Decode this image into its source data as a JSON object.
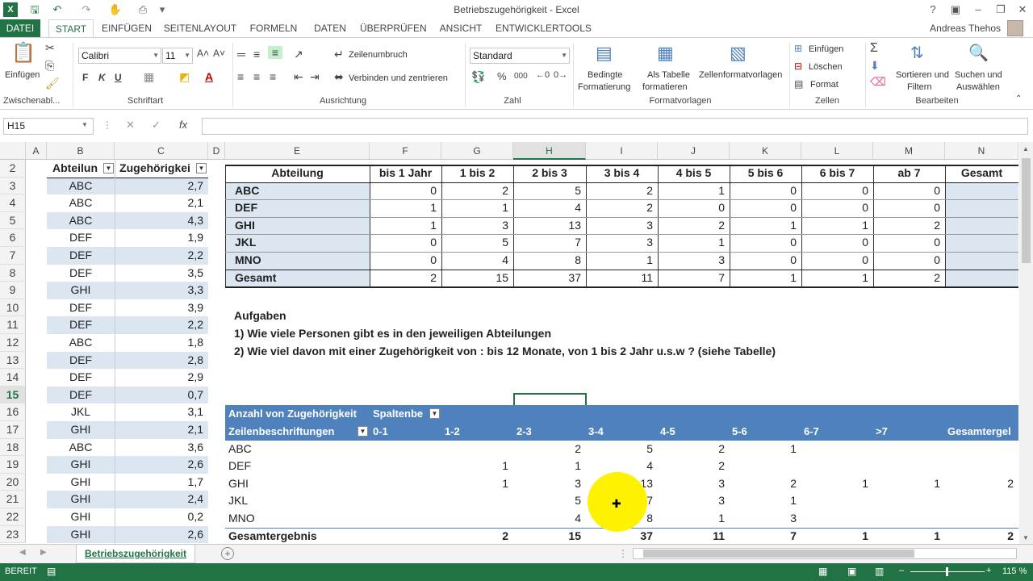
{
  "window": {
    "title": "Betriebszugehörigkeit - Excel",
    "user": "Andreas Thehos"
  },
  "qat": {
    "save_icon": "save-icon",
    "undo_icon": "undo-icon",
    "redo_icon": "redo-icon"
  },
  "tabs": [
    "DATEI",
    "START",
    "EINFÜGEN",
    "SEITENLAYOUT",
    "FORMELN",
    "DATEN",
    "ÜBERPRÜFEN",
    "ANSICHT",
    "ENTWICKLERTOOLS"
  ],
  "ribbon": {
    "clipboard": {
      "paste": "Einfügen",
      "label": "Zwischenabl..."
    },
    "font": {
      "name": "Calibri",
      "size": "11",
      "bold": "F",
      "italic": "K",
      "underline": "U",
      "label": "Schriftart"
    },
    "alignment": {
      "wrap": "Zeilenumbruch",
      "merge": "Verbinden und zentrieren",
      "label": "Ausrichtung"
    },
    "number": {
      "format": "Standard",
      "percent": "%",
      "thousands": "000",
      "label": "Zahl"
    },
    "styles": {
      "conditional1": "Bedingte",
      "conditional2": "Formatierung",
      "table1": "Als Tabelle",
      "table2": "formatieren",
      "cellstyles": "Zellenformatvorlagen",
      "label": "Formatvorlagen"
    },
    "cells": {
      "insert": "Einfügen",
      "delete": "Löschen",
      "format": "Format",
      "label": "Zellen"
    },
    "editing": {
      "sort1": "Sortieren und",
      "sort2": "Filtern",
      "find1": "Suchen und",
      "find2": "Auswählen",
      "label": "Bearbeiten"
    }
  },
  "formula": {
    "namebox": "H15",
    "fx": "fx",
    "value": ""
  },
  "columns": [
    "A",
    "B",
    "C",
    "D",
    "E",
    "F",
    "G",
    "H",
    "I",
    "J",
    "K",
    "L",
    "M",
    "N"
  ],
  "rows": [
    "2",
    "3",
    "4",
    "5",
    "6",
    "7",
    "8",
    "9",
    "10",
    "11",
    "12",
    "13",
    "14",
    "15",
    "16",
    "17",
    "18",
    "19",
    "20",
    "21",
    "22",
    "23"
  ],
  "left_table": {
    "headers": [
      "Abteilun",
      "Zugehörigkei"
    ],
    "rows": [
      [
        "ABC",
        "2,7"
      ],
      [
        "ABC",
        "2,1"
      ],
      [
        "ABC",
        "4,3"
      ],
      [
        "DEF",
        "1,9"
      ],
      [
        "DEF",
        "2,2"
      ],
      [
        "DEF",
        "3,5"
      ],
      [
        "GHI",
        "3,3"
      ],
      [
        "DEF",
        "3,9"
      ],
      [
        "DEF",
        "2,2"
      ],
      [
        "ABC",
        "1,8"
      ],
      [
        "DEF",
        "2,8"
      ],
      [
        "DEF",
        "2,9"
      ],
      [
        "DEF",
        "0,7"
      ],
      [
        "JKL",
        "3,1"
      ],
      [
        "GHI",
        "2,1"
      ],
      [
        "ABC",
        "3,6"
      ],
      [
        "GHI",
        "2,6"
      ],
      [
        "GHI",
        "1,7"
      ],
      [
        "GHI",
        "2,4"
      ],
      [
        "GHI",
        "0,2"
      ],
      [
        "GHI",
        "2,6"
      ]
    ]
  },
  "summary_table": {
    "headers": [
      "Abteilung",
      "bis 1 Jahr",
      "1 bis 2",
      "2 bis 3",
      "3 bis 4",
      "4 bis 5",
      "5 bis 6",
      "6 bis 7",
      "ab 7",
      "Gesamt"
    ],
    "rows": [
      [
        "ABC",
        "0",
        "2",
        "5",
        "2",
        "1",
        "0",
        "0",
        "0",
        ""
      ],
      [
        "DEF",
        "1",
        "1",
        "4",
        "2",
        "0",
        "0",
        "0",
        "0",
        ""
      ],
      [
        "GHI",
        "1",
        "3",
        "13",
        "3",
        "2",
        "1",
        "1",
        "2",
        ""
      ],
      [
        "JKL",
        "0",
        "5",
        "7",
        "3",
        "1",
        "0",
        "0",
        "0",
        ""
      ],
      [
        "MNO",
        "0",
        "4",
        "8",
        "1",
        "3",
        "0",
        "0",
        "0",
        ""
      ],
      [
        "Gesamt",
        "2",
        "15",
        "37",
        "11",
        "7",
        "1",
        "1",
        "2",
        ""
      ]
    ]
  },
  "tasks": {
    "title": "Aufgaben",
    "line1": "1) Wie viele Personen gibt es in den jeweiligen Abteilungen",
    "line2": "2) Wie viel davon mit einer Zugehörigkeit von : bis 12 Monate, von 1 bis 2 Jahr u.s.w ? (siehe Tabelle)"
  },
  "pivot": {
    "header1": "Anzahl von Zugehörigkeit",
    "header1b": "Spaltenbe",
    "rowlabel": "Zeilenbeschriftungen",
    "cols": [
      "0-1",
      "1-2",
      "2-3",
      "3-4",
      "4-5",
      "5-6",
      "6-7",
      ">7",
      "Gesamtergel"
    ],
    "rows": [
      [
        "ABC",
        "",
        "",
        "2",
        "5",
        "2",
        "1",
        "",
        "",
        ""
      ],
      [
        "DEF",
        "",
        "1",
        "1",
        "4",
        "2",
        "",
        "",
        "",
        ""
      ],
      [
        "GHI",
        "",
        "1",
        "3",
        "13",
        "3",
        "2",
        "1",
        "1",
        "2"
      ],
      [
        "JKL",
        "",
        "",
        "5",
        "7",
        "3",
        "1",
        "",
        "",
        ""
      ],
      [
        "MNO",
        "",
        "",
        "4",
        "8",
        "1",
        "3",
        "",
        "",
        ""
      ],
      [
        "Gesamtergebnis",
        "",
        "2",
        "15",
        "37",
        "11",
        "7",
        "1",
        "1",
        "2"
      ]
    ]
  },
  "sheet": {
    "tab": "Betriebszugehörigkeit"
  },
  "status": {
    "mode": "BEREIT",
    "zoom": "115 %"
  }
}
